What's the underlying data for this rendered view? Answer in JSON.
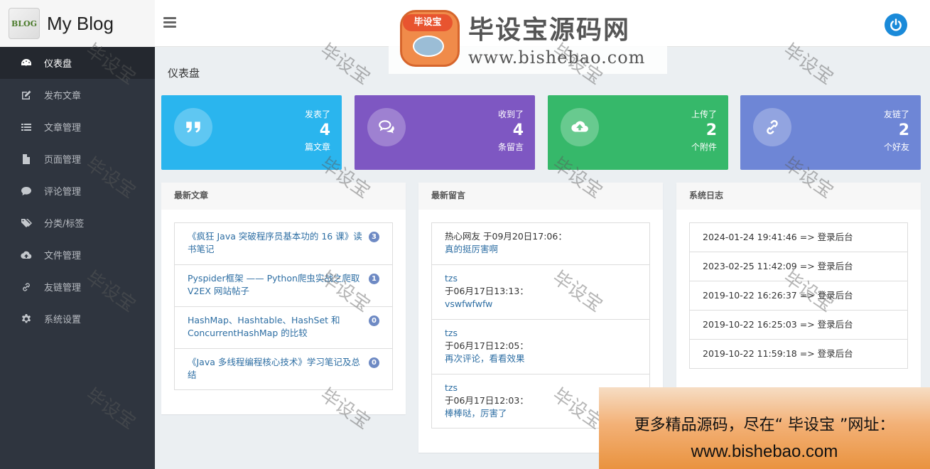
{
  "brand": {
    "name": "My Blog",
    "logo_text": "BLOG"
  },
  "banner": {
    "logo_text": "毕设宝",
    "title": "毕设宝源码网",
    "url": "www.bishebao.com"
  },
  "sidebar": {
    "items": [
      {
        "label": "仪表盘",
        "icon": "dashboard-icon",
        "active": true
      },
      {
        "label": "发布文章",
        "icon": "edit-icon"
      },
      {
        "label": "文章管理",
        "icon": "list-icon"
      },
      {
        "label": "页面管理",
        "icon": "file-icon"
      },
      {
        "label": "评论管理",
        "icon": "comments-icon"
      },
      {
        "label": "分类/标签",
        "icon": "tags-icon"
      },
      {
        "label": "文件管理",
        "icon": "cloud-upload-icon"
      },
      {
        "label": "友链管理",
        "icon": "link-icon"
      },
      {
        "label": "系统设置",
        "icon": "gear-icon"
      }
    ]
  },
  "page_title": "仪表盘",
  "stats": [
    {
      "line1": "发表了",
      "count": "4",
      "line2": "篇文章",
      "color": "#2ab5ee",
      "icon": "quote-icon"
    },
    {
      "line1": "收到了",
      "count": "4",
      "line2": "条留言",
      "color": "#7e57c2",
      "icon": "comments-icon"
    },
    {
      "line1": "上传了",
      "count": "2",
      "line2": "个附件",
      "color": "#36b86a",
      "icon": "cloud-upload-icon"
    },
    {
      "line1": "友链了",
      "count": "2",
      "line2": "个好友",
      "color": "#6e86d6",
      "icon": "link-icon"
    }
  ],
  "panels": {
    "articles": {
      "title": "最新文章",
      "items": [
        {
          "text": "《疯狂 Java 突破程序员基本功的 16 课》读书笔记",
          "count": "3"
        },
        {
          "text": "Pyspider框架 —— Python爬虫实战之爬取 V2EX 网站帖子",
          "count": "1"
        },
        {
          "text": "HashMap、Hashtable、HashSet 和 ConcurrentHashMap 的比较",
          "count": "0"
        },
        {
          "text": "《Java 多线程编程核心技术》学习笔记及总结",
          "count": "0"
        }
      ]
    },
    "comments": {
      "title": "最新留言",
      "items": [
        {
          "author": "热心网友",
          "time": "于09月20日17:06：",
          "content": "真的挺厉害啊",
          "inline": true
        },
        {
          "author": "tzs",
          "time": "于06月17日13:13：",
          "content": "vswfwfwfw",
          "inline": false
        },
        {
          "author": "tzs",
          "time": "于06月17日12:05：",
          "content": "再次评论，看看效果",
          "inline": false
        },
        {
          "author": "tzs",
          "time": "于06月17日12:03：",
          "content": "棒棒哒，厉害了",
          "inline": false
        }
      ]
    },
    "logs": {
      "title": "系统日志",
      "items": [
        "2024-01-24 19:41:46 => 登录后台",
        "2023-02-25 11:42:09 => 登录后台",
        "2019-10-22 16:26:37 => 登录后台",
        "2019-10-22 16:25:03 => 登录后台",
        "2019-10-22 11:59:18 => 登录后台"
      ]
    }
  },
  "watermark": "毕设宝",
  "promo": {
    "line1": "更多精品源码，尽在“ 毕设宝 ”网址：",
    "line2": "www.bishebao.com"
  }
}
